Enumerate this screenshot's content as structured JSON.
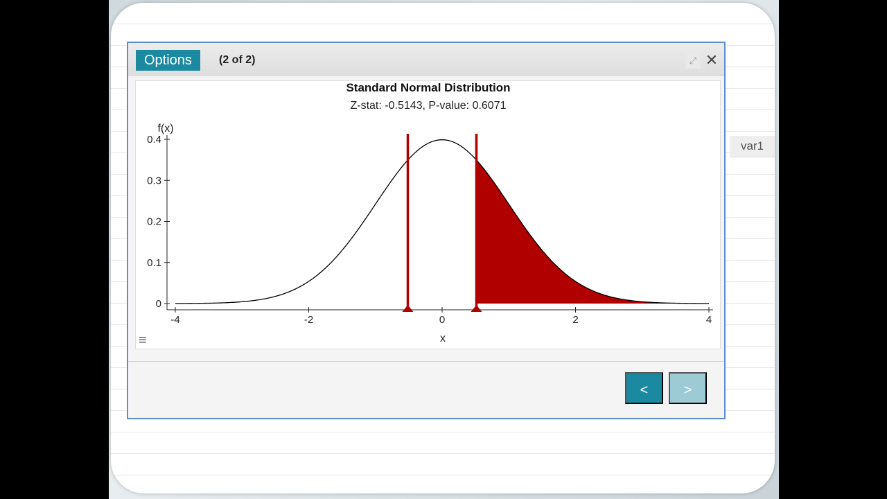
{
  "background_sheet": {
    "column_header": "var1"
  },
  "dialog": {
    "options_label": "Options",
    "page_indicator": "(2 of 2)",
    "expand_icon": "expand-icon",
    "close_icon": "close-icon",
    "prev_label": "<",
    "next_label": ">"
  },
  "chart_data": {
    "type": "area",
    "title": "Standard Normal Distribution",
    "subtitle": "Z-stat: -0.5143, P-value: 0.6071",
    "xlabel": "x",
    "ylabel": "f(x)",
    "xlim": [
      -4,
      4
    ],
    "ylim": [
      0,
      0.4
    ],
    "x_ticks": [
      "-4",
      "-2",
      "0",
      "2",
      "4"
    ],
    "y_ticks": [
      "0",
      "0.1",
      "0.2",
      "0.3",
      "0.4"
    ],
    "critical_lines": [
      -0.5143,
      0.5143
    ],
    "shaded_region": [
      0.5143,
      4
    ],
    "shade_color": "#b00000",
    "curve_color": "#000000"
  }
}
